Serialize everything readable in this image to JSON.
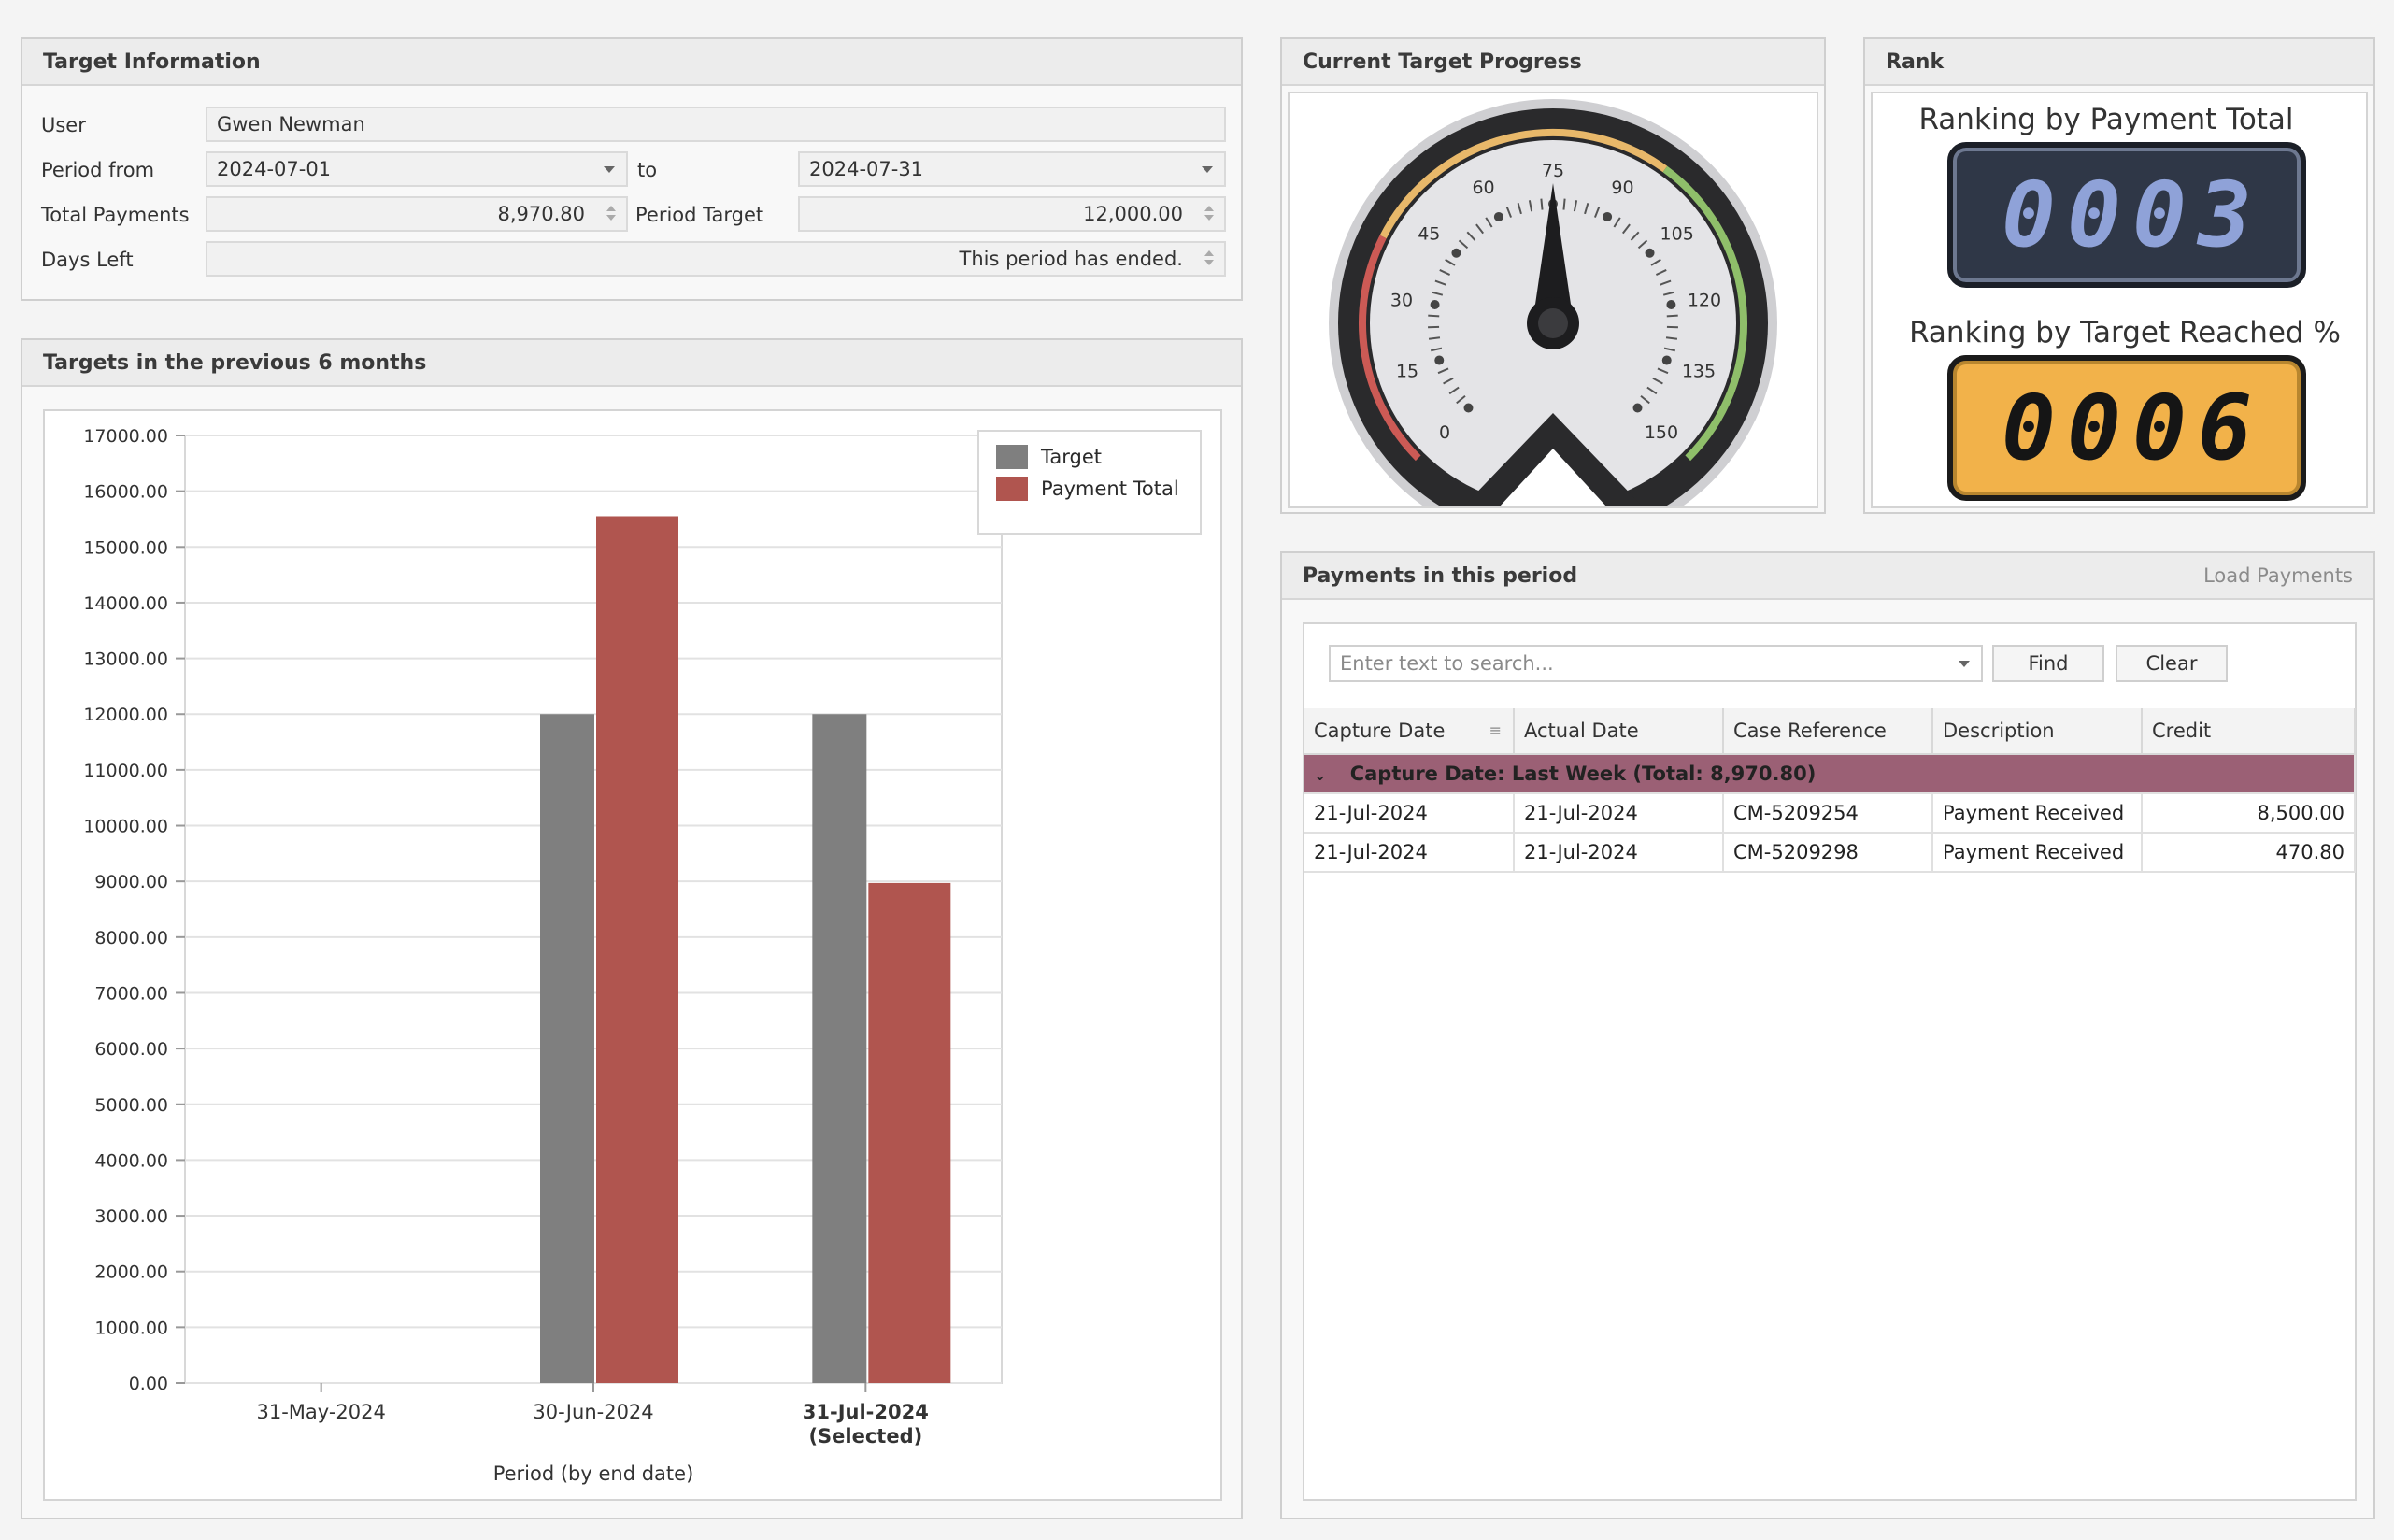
{
  "target_info": {
    "title": "Target Information",
    "user_label": "User",
    "user_value": "Gwen Newman",
    "period_from_label": "Period from",
    "period_from_value": "2024-07-01",
    "to_label": "to",
    "period_to_value": "2024-07-31",
    "total_payments_label": "Total Payments",
    "total_payments_value": "8,970.80",
    "period_target_label": "Period Target",
    "period_target_value": "12,000.00",
    "days_left_label": "Days Left",
    "days_left_value": "This period has ended."
  },
  "targets_panel": {
    "title": "Targets in the previous 6 months"
  },
  "chart_data": {
    "type": "bar",
    "categories": [
      "31-May-2024",
      "30-Jun-2024",
      "31-Jul-2024"
    ],
    "category_sublabels": [
      "",
      "",
      "(Selected)"
    ],
    "selected_index": 2,
    "series": [
      {
        "name": "Target",
        "color": "#7f7f7f",
        "values": [
          0,
          12000,
          12000
        ]
      },
      {
        "name": "Payment Total",
        "color": "#b0554f",
        "values": [
          0,
          15550,
          8970.8
        ]
      }
    ],
    "xlabel": "Period (by end date)",
    "ylabel": "",
    "ylim": [
      0,
      17000
    ],
    "ytick_step": 1000,
    "ytick_labels": [
      "0.00",
      "1000.00",
      "2000.00",
      "3000.00",
      "4000.00",
      "5000.00",
      "6000.00",
      "7000.00",
      "8000.00",
      "9000.00",
      "10000.00",
      "11000.00",
      "12000.00",
      "13000.00",
      "14000.00",
      "15000.00",
      "16000.00",
      "17000.00"
    ],
    "grid": true,
    "legend_position": "top-right"
  },
  "progress_panel": {
    "title": "Current Target Progress",
    "gauge": {
      "min": 0,
      "max": 150,
      "value": 75,
      "labels": [
        "0",
        "15",
        "30",
        "45",
        "60",
        "75",
        "90",
        "105",
        "120",
        "135",
        "150"
      ],
      "range_colors": [
        "#cc5a55",
        "#e8b86a",
        "#8fbf6a"
      ]
    }
  },
  "rank_panel": {
    "title": "Rank",
    "payment_caption": "Ranking by Payment Total",
    "payment_digits": [
      "0",
      "0",
      "0",
      "3"
    ],
    "target_caption": "Ranking by Target Reached %",
    "target_digits": [
      "0",
      "0",
      "0",
      "6"
    ]
  },
  "payments_panel": {
    "title": "Payments in this period",
    "load_link": "Load Payments",
    "search_placeholder": "Enter text to search...",
    "find_label": "Find",
    "clear_label": "Clear",
    "columns": [
      "Capture Date",
      "Actual Date",
      "Case Reference",
      "Description",
      "Credit"
    ],
    "group_label": "Capture Date: Last Week (Total: 8,970.80)",
    "rows": [
      {
        "capture_date": "21-Jul-2024",
        "actual_date": "21-Jul-2024",
        "case_ref": "CM-5209254",
        "description": "Payment Received",
        "credit": "8,500.00"
      },
      {
        "capture_date": "21-Jul-2024",
        "actual_date": "21-Jul-2024",
        "case_ref": "CM-5209298",
        "description": "Payment Received",
        "credit": "470.80"
      }
    ]
  }
}
